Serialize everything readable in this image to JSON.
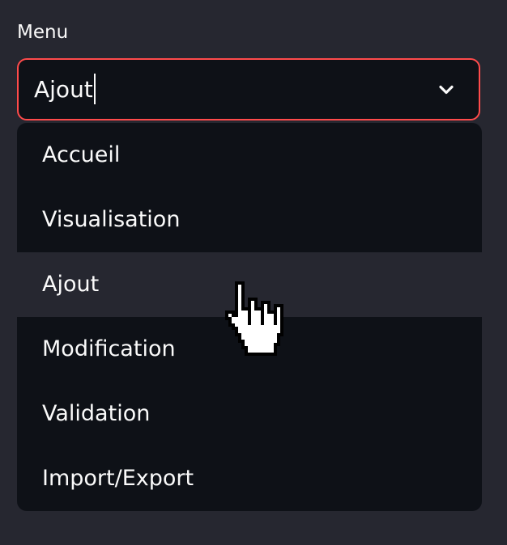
{
  "label": "Menu",
  "select": {
    "value": "Ajout"
  },
  "options": [
    {
      "label": "Accueil"
    },
    {
      "label": "Visualisation"
    },
    {
      "label": "Ajout"
    },
    {
      "label": "Modification"
    },
    {
      "label": "Validation"
    },
    {
      "label": "Import/Export"
    }
  ],
  "highlighted_option": "Ajout",
  "accent_color": "#ff4b4b",
  "icons": {
    "select_toggle": "chevron-down-icon",
    "pointer": "hand-pointer-cursor-icon"
  }
}
